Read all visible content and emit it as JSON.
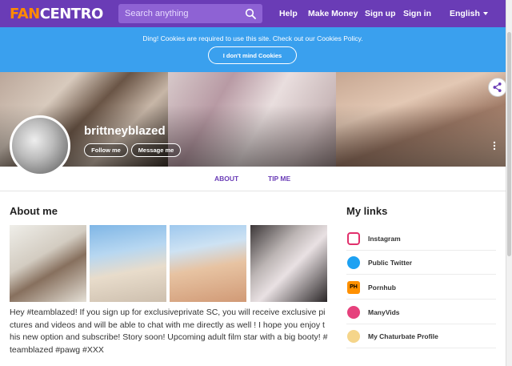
{
  "header": {
    "logo_part1": "FAN",
    "logo_part2": "CENTRO",
    "search_placeholder": "Search anything",
    "nav": [
      "Help",
      "Make Money",
      "Sign up",
      "Sign in"
    ],
    "language": "English"
  },
  "cookie": {
    "message": "Ding! Cookies are required to use this site. Check out our Cookies Policy.",
    "button": "I don't mind Cookies"
  },
  "profile": {
    "username": "brittneyblazed",
    "follow_label": "Follow me",
    "message_label": "Message me"
  },
  "tabs": [
    "ABOUT",
    "TIP ME"
  ],
  "about": {
    "heading": "About me",
    "bio": "Hey #teamblazed! If you sign up for exclusiveprivate SC, you will receive exclusive pictures and videos and will be able to chat with me directly as well ! I hope you enjoy this new option  and subscribe! Story soon! Upcoming adult film star with a big booty! #teamblazed #pawg #XXX"
  },
  "links": {
    "heading": "My links",
    "items": [
      {
        "label": "Instagram",
        "icon": "instagram-icon"
      },
      {
        "label": "Public Twitter",
        "icon": "twitter-icon"
      },
      {
        "label": "Pornhub",
        "icon": "pornhub-icon",
        "icon_text": "PH"
      },
      {
        "label": "ManyVids",
        "icon": "manyvids-icon"
      },
      {
        "label": "My Chaturbate Profile",
        "icon": "chaturbate-icon"
      }
    ]
  },
  "colors": {
    "brand_purple": "#6a3cb6",
    "cookie_blue": "#3aa0ee",
    "logo_orange": "#ff8a00"
  }
}
